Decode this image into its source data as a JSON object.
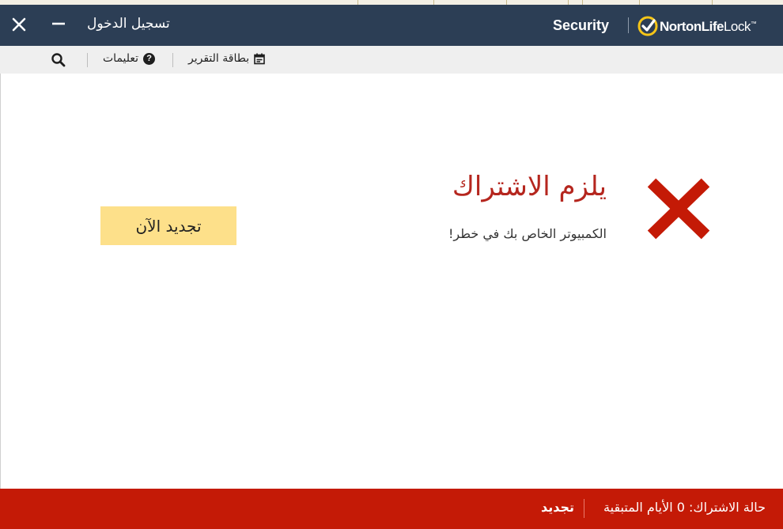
{
  "titlebar": {
    "login_label": "تسجيل الدخول",
    "product_name": "Security",
    "brand_name_bold": "NortonLife",
    "brand_name_light": "Lock",
    "brand_trademark": "™",
    "background_color": "#2c3e55"
  },
  "toolbar": {
    "report_card_label": "بطاقة التقرير",
    "help_label": "تعليمات",
    "help_icon_glyph": "?"
  },
  "alert": {
    "headline": "يلزم الاشتراك",
    "message": "الكمبيوتر الخاص بك في خطر!",
    "icon": "x-mark-icon",
    "icon_color": "#c41a06"
  },
  "actions": {
    "renew_now_label": "تجديد الآن",
    "renew_now_color": "#fde08a"
  },
  "status": {
    "subscription_label": "حالة الاشتراك:",
    "days_remaining": "0",
    "days_remaining_text": "الأيام المتبقية",
    "renew_link": "تجديد",
    "bar_color": "#c41a06"
  }
}
